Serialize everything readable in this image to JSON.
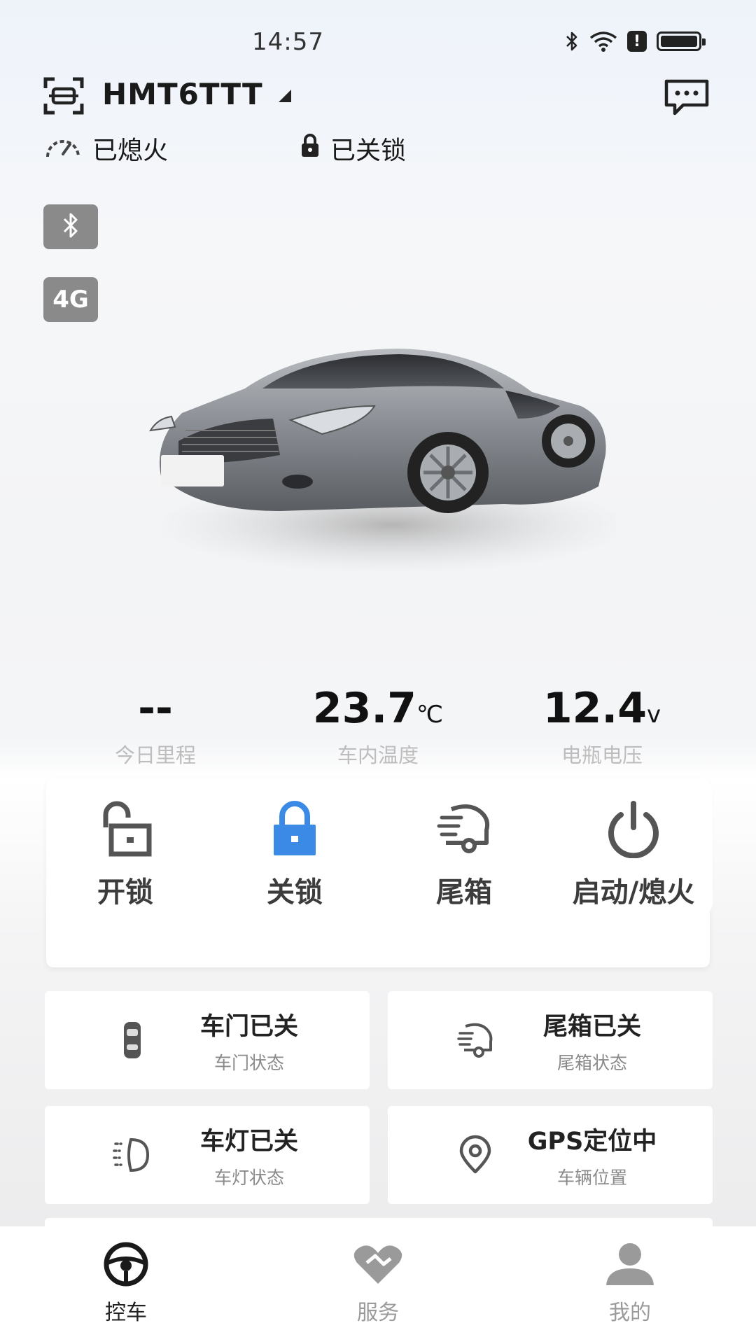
{
  "status_bar": {
    "time": "14:57",
    "alert_glyph": "!"
  },
  "header": {
    "plate": "HMT6TTT",
    "engine_status": "已熄火",
    "lock_status": "已关锁"
  },
  "connectivity": {
    "bt_label": "bluetooth-icon",
    "net_label": "4G"
  },
  "stats": [
    {
      "value": "--",
      "unit": "",
      "label": "今日里程"
    },
    {
      "value": "23.7",
      "unit": "℃",
      "label": "车内温度"
    },
    {
      "value": "12.4",
      "unit": "v",
      "label": "电瓶电压"
    }
  ],
  "controls": [
    {
      "label": "开锁",
      "icon": "unlock-icon"
    },
    {
      "label": "关锁",
      "icon": "lock-icon"
    },
    {
      "label": "尾箱",
      "icon": "trunk-icon"
    },
    {
      "label": "启动/熄火",
      "icon": "power-icon"
    }
  ],
  "cards": [
    {
      "title": "车门已关",
      "sub": "车门状态",
      "icon": "car-door-icon"
    },
    {
      "title": "尾箱已关",
      "sub": "尾箱状态",
      "icon": "trunk-icon"
    },
    {
      "title": "车灯已关",
      "sub": "车灯状态",
      "icon": "headlight-icon"
    },
    {
      "title": "GPS定位中",
      "sub": "车辆位置",
      "icon": "location-pin-icon"
    }
  ],
  "nav": [
    {
      "label": "控车",
      "icon": "steering-wheel-icon",
      "active": true
    },
    {
      "label": "服务",
      "icon": "handshake-heart-icon",
      "active": false
    },
    {
      "label": "我的",
      "icon": "user-icon",
      "active": false
    }
  ],
  "colors": {
    "accent_blue": "#3b8be6",
    "icon_grey": "#555555",
    "badge_grey": "#8a8a8a"
  }
}
